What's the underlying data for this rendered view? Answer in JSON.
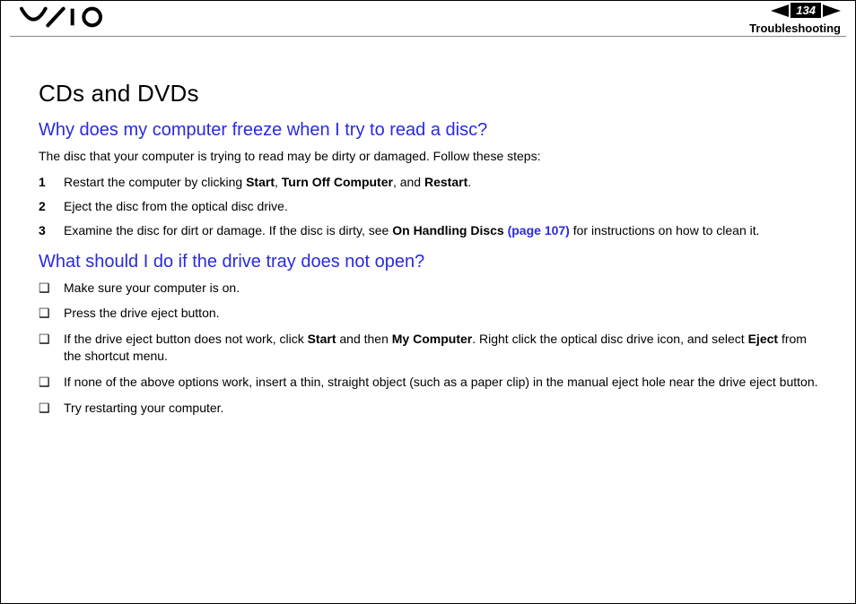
{
  "header": {
    "page_number": "134",
    "section": "Troubleshooting"
  },
  "content": {
    "title": "CDs and DVDs",
    "q1": {
      "heading": "Why does my computer freeze when I try to read a disc?",
      "intro": "The disc that your computer is trying to read may be dirty or damaged. Follow these steps:",
      "steps": [
        {
          "n": "1",
          "pre": "Restart the computer by clicking ",
          "b1": "Start",
          "mid1": ", ",
          "b2": "Turn Off Computer",
          "mid2": ", and ",
          "b3": "Restart",
          "post": "."
        },
        {
          "n": "2",
          "plain": "Eject the disc from the optical disc drive."
        },
        {
          "n": "3",
          "pre": "Examine the disc for dirt or damage. If the disc is dirty, see ",
          "b1": "On Handling Discs ",
          "link": "(page 107)",
          "post": " for instructions on how to clean it."
        }
      ]
    },
    "q2": {
      "heading": "What should I do if the drive tray does not open?",
      "bullets": [
        {
          "plain": "Make sure your computer is on."
        },
        {
          "plain": "Press the drive eject button."
        },
        {
          "pre": "If the drive eject button does not work, click ",
          "b1": "Start",
          "mid1": " and then ",
          "b2": "My Computer",
          "mid2": ". Right click the optical disc drive icon, and select ",
          "b3": "Eject",
          "post": " from the shortcut menu."
        },
        {
          "plain": "If none of the above options work, insert a thin, straight object (such as a paper clip) in the manual eject hole near the drive eject button."
        },
        {
          "plain": "Try restarting your computer."
        }
      ]
    }
  },
  "glyphs": {
    "check_square": "❑"
  }
}
